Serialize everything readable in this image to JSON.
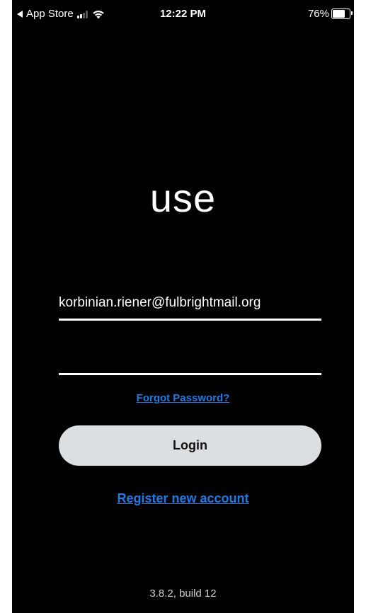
{
  "status_bar": {
    "back_label": "App Store",
    "time": "12:22 PM",
    "battery_percent": "76%",
    "battery_level": 0.76,
    "icons": [
      "back-arrow-icon",
      "signal-icon",
      "wifi-icon",
      "battery-icon"
    ]
  },
  "logo": {
    "text": "use"
  },
  "login_form": {
    "email_value": "korbinian.riener@fulbrightmail.org",
    "password_value": "",
    "forgot_password_label": "Forgot Password?",
    "login_label": "Login",
    "register_label": "Register new account"
  },
  "footer": {
    "version": "3.8.2, build 12"
  },
  "colors": {
    "background": "#000000",
    "link": "#1e7be6",
    "button_bg": "#dcdfe2",
    "text": "#ffffff"
  }
}
